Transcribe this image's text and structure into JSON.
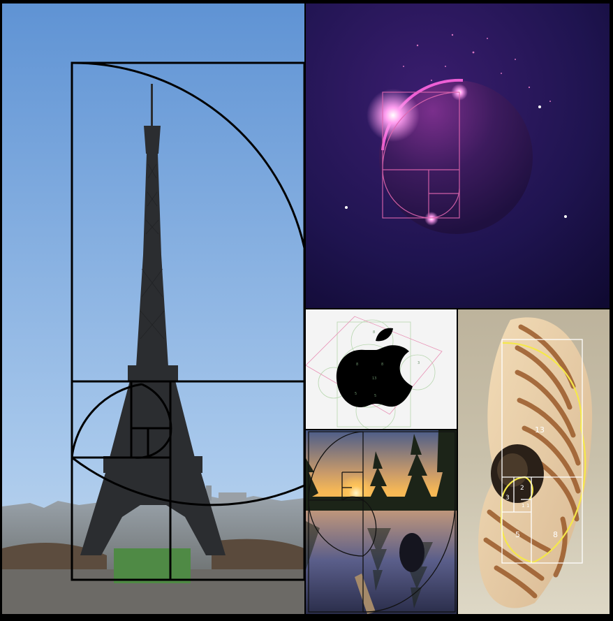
{
  "collage": {
    "panels": [
      {
        "subject": "Eiffel Tower with golden spiral overlay",
        "icon": "eiffel-tower-photo"
      },
      {
        "subject": "Glowing planet with golden spiral overlay",
        "icon": "planet-photo"
      },
      {
        "subject": "Apple logo with golden circle construction",
        "icon": "apple-logo"
      },
      {
        "subject": "Sunset reflection in lake with golden spiral",
        "icon": "sunset-photo"
      },
      {
        "subject": "Nautilus shell with golden spiral",
        "icon": "nautilus-shell-photo"
      }
    ]
  },
  "overlay": {
    "eiffel_stroke": "#000000",
    "space_stroke": "#e066b0",
    "apple_stroke": "#b8d7b0",
    "sunset_stroke": "#111111",
    "shell_stroke": "#f5e84a"
  },
  "nautilus": {
    "labels": [
      "13",
      "8",
      "5",
      "3",
      "2",
      "1",
      "1"
    ]
  },
  "apple": {
    "labels": [
      "8",
      "8",
      "8",
      "13",
      "5",
      "5",
      "3"
    ]
  }
}
